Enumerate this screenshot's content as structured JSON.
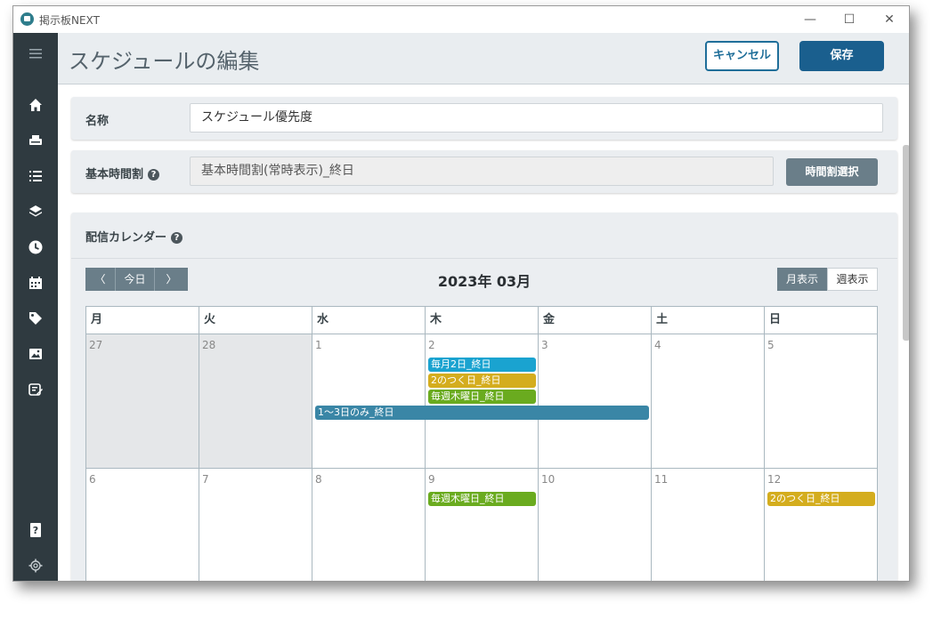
{
  "window": {
    "title": "掲示板NEXT",
    "minimize": "—",
    "maximize": "☐",
    "close": "✕"
  },
  "sidebar": {
    "icons": [
      "menu-icon",
      "home-icon",
      "printer-icon",
      "list-icon",
      "layers-icon",
      "clock-icon",
      "calendar-icon",
      "tag-icon",
      "image-icon",
      "edit-icon",
      "help-icon",
      "gear-icon"
    ],
    "help_label": "?",
    "gear_label": "⚙"
  },
  "header": {
    "title": "スケジュールの編集",
    "cancel_label": "キャンセル",
    "save_label": "保存"
  },
  "form": {
    "name_label": "名称",
    "name_value": "スケジュール優先度",
    "base_label": "基本時間割",
    "base_value": "基本時間割(常時表示)_終日",
    "base_button": "時間割選択",
    "calendar_label": "配信カレンダー",
    "help_mark": "?"
  },
  "calendar": {
    "prev": "〈",
    "today": "今日",
    "next": "〉",
    "month_title": "2023年 03月",
    "view_month": "月表示",
    "view_week": "週表示",
    "weekdays": [
      "月",
      "火",
      "水",
      "木",
      "金",
      "土",
      "日"
    ],
    "weeks": [
      [
        "27",
        "28",
        "1",
        "2",
        "3",
        "4",
        "5"
      ],
      [
        "6",
        "7",
        "8",
        "9",
        "10",
        "11",
        "12"
      ]
    ],
    "events": {
      "monthly2": "毎月2日_終日",
      "twos1": "2のつく日_終日",
      "thursday1": "毎週木曜日_終日",
      "range13": "1～3日のみ_終日",
      "thursday2": "毎週木曜日_終日",
      "twos2": "2のつく日_終日"
    }
  },
  "colors": {
    "sidebar": "#2f3a40",
    "primary": "#1a5f8e",
    "event_cyan": "#1aa3d0",
    "event_yellow": "#d4ad1e",
    "event_green": "#6aab1f",
    "event_blue": "#3a86a6"
  }
}
